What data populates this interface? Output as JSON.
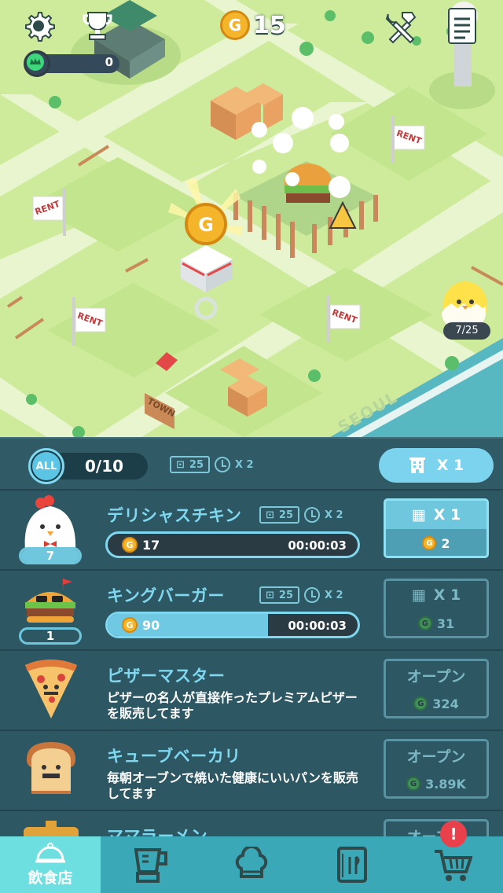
{
  "header": {
    "coins": "15",
    "coin_symbol": "G",
    "crown_points": "0",
    "icons": [
      "settings-icon",
      "trophy-icon",
      "build-tools-icon",
      "quest-list-icon"
    ]
  },
  "map": {
    "rent_signs": [
      "RENT",
      "RENT",
      "RENT",
      "RENT",
      "RENT"
    ],
    "town_sign": "TOWN",
    "district_label": "SEOUL",
    "egg_progress": "7/25"
  },
  "filter": {
    "all_label": "ALL",
    "count": "0/10",
    "lock_value": "25",
    "speed": "X 2",
    "multiplier": "X 1"
  },
  "restaurants": [
    {
      "name": "デリシャスチキン",
      "level": "7",
      "level_fill": 1.0,
      "lock": "25",
      "speed": "X 2",
      "income": "17",
      "time": "00:00:03",
      "progress": 0.0,
      "btn_top": "X 1",
      "btn_cost": "2",
      "active": true
    },
    {
      "name": "キングバーガー",
      "level": "1",
      "level_fill": 0.0,
      "lock": "25",
      "speed": "X 2",
      "income": "90",
      "time": "00:00:03",
      "progress": 0.64,
      "btn_top": "X 1",
      "btn_cost": "31",
      "active": false
    },
    {
      "name": "ピザーマスター",
      "desc": "ピザーの名人が直接作ったプレミアムピザーを販売してます",
      "btn_top": "オープン",
      "btn_cost": "324"
    },
    {
      "name": "キューブベーカリ",
      "desc": "毎朝オーブンで焼いた健康にいいパンを販売してます",
      "btn_top": "オープン",
      "btn_cost": "3.89K"
    },
    {
      "name": "ママラーメン",
      "btn_top": "オープン"
    }
  ],
  "tabs": [
    {
      "label": "飲食店",
      "icon": "cloche-icon",
      "active": true
    },
    {
      "label": "",
      "icon": "blender-icon"
    },
    {
      "label": "",
      "icon": "chef-hat-icon"
    },
    {
      "label": "",
      "icon": "menu-book-icon"
    },
    {
      "label": "",
      "icon": "cart-icon"
    }
  ],
  "cart_alert": "!",
  "colors": {
    "accent": "#7fd8ef",
    "panel": "#2d5763",
    "tabbar": "#3aa8b7",
    "coin": "#f4b52b",
    "alert": "#e8414c"
  }
}
